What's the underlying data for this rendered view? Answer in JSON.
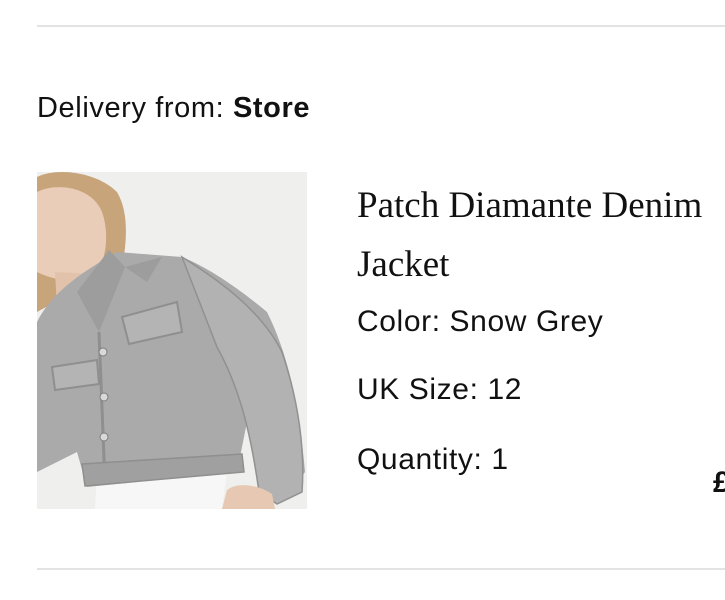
{
  "delivery": {
    "label": "Delivery from:",
    "source": "Store"
  },
  "product": {
    "name_line1": "Patch Diamante Denim",
    "name_line2": "Jacket",
    "color": "Color: Snow Grey",
    "size": "UK Size: 12",
    "quantity": "Quantity: 1",
    "price_partial": "£",
    "image_alt": "Patch Diamante Denim Jacket"
  },
  "colors": {
    "text": "#111111",
    "divider": "#e3e3e3",
    "image_bg": "#efefee",
    "denim": "#a9aaa9"
  }
}
